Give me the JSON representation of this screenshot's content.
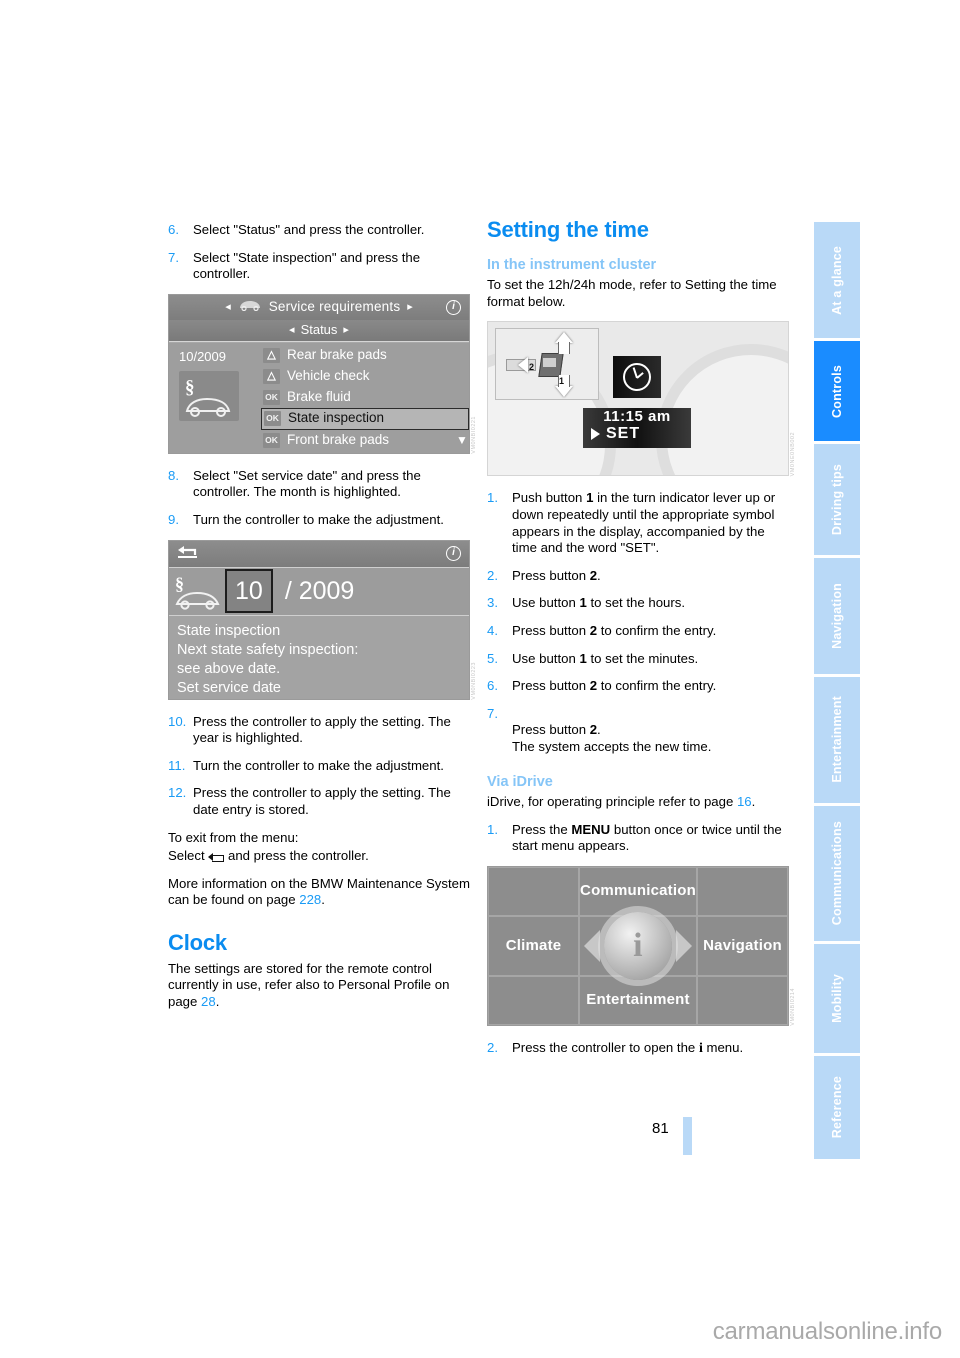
{
  "document": {
    "page_number": "81",
    "watermark": "carmanualsonline.info"
  },
  "tabs": [
    {
      "label": "At a glance",
      "active": false
    },
    {
      "label": "Controls",
      "active": true
    },
    {
      "label": "Driving tips",
      "active": false
    },
    {
      "label": "Navigation",
      "active": false
    },
    {
      "label": "Entertainment",
      "active": false
    },
    {
      "label": "Communications",
      "active": false
    },
    {
      "label": "Mobility",
      "active": false
    },
    {
      "label": "Reference",
      "active": false
    }
  ],
  "colors": {
    "accent_blue": "#0a8cf0",
    "step_number_blue": "#1a9bf5",
    "light_blue": "#85c5f7",
    "tab_inactive": "#b9d9f7",
    "tab_active": "#1a8cff"
  },
  "left_column": {
    "steps_top": [
      {
        "num": "6.",
        "text": "Select \"Status\" and press the controller."
      },
      {
        "num": "7.",
        "text": "Select \"State inspection\" and press the controller."
      }
    ],
    "figure_service": {
      "header_title": "Service requirements",
      "subheader": "Status",
      "date": "10/2009",
      "rows": [
        {
          "badge": "warn",
          "label": "Rear brake pads",
          "selected": false
        },
        {
          "badge": "warn",
          "label": "Vehicle check",
          "selected": false
        },
        {
          "badge": "OK",
          "label": "Brake fluid",
          "selected": false
        },
        {
          "badge": "OK",
          "label": "State inspection",
          "selected": true
        },
        {
          "badge": "OK",
          "label": "Front brake pads",
          "selected": false
        }
      ],
      "code": "VM0NBI0221"
    },
    "steps_mid": [
      {
        "num": "8.",
        "text": "Select \"Set service date\" and press the controller. The month is highlighted."
      },
      {
        "num": "9.",
        "text": "Turn the controller to make the adjustment."
      }
    ],
    "figure_date": {
      "month": "10",
      "year": "/ 2009",
      "lines": [
        "State inspection",
        "Next state safety inspection:",
        "see above date.",
        "Set service date"
      ],
      "code": "VM0NBI0223"
    },
    "steps_bottom": [
      {
        "num": "10.",
        "text": "Press the controller to apply the setting. The year is highlighted."
      },
      {
        "num": "11.",
        "text": "Turn the controller to make the adjustment."
      },
      {
        "num": "12.",
        "text": "Press the controller to apply the setting. The date entry is stored."
      }
    ],
    "exit_line1": "To exit from the menu:",
    "exit_line2_pre": "Select",
    "exit_line2_post": "and press the controller.",
    "more_info_pre": "More information on the BMW Maintenance System can be found on page",
    "more_info_page": "228",
    "more_info_post": ".",
    "clock_heading": "Clock",
    "clock_body_pre": "The settings are stored for the remote control currently in use, refer also to Personal Profile on page",
    "clock_body_page": "28",
    "clock_body_post": "."
  },
  "right_column": {
    "heading": "Setting the time",
    "subheading_cluster": "In the instrument cluster",
    "intro": "To set the 12h/24h mode, refer to Setting the time format below.",
    "figure_cluster": {
      "time": "11:15 am",
      "set_label": "SET",
      "button_1": "1",
      "button_2": "2",
      "code": "VM0NE0NB002"
    },
    "steps_cluster": [
      {
        "num": "1.",
        "parts": [
          "Push button ",
          "1",
          " in the turn indicator lever up or down repeatedly until the appropriate symbol appears in the display, accompanied by the time and the word \"SET\"."
        ]
      },
      {
        "num": "2.",
        "parts": [
          "Press button ",
          "2",
          "."
        ]
      },
      {
        "num": "3.",
        "parts": [
          "Use button ",
          "1",
          " to set the hours."
        ]
      },
      {
        "num": "4.",
        "parts": [
          "Press button ",
          "2",
          " to confirm the entry."
        ]
      },
      {
        "num": "5.",
        "parts": [
          "Use button ",
          "1",
          " to set the minutes."
        ]
      },
      {
        "num": "6.",
        "parts": [
          "Press button ",
          "2",
          " to confirm the entry."
        ]
      },
      {
        "num": "7.",
        "parts": [
          "Press button ",
          "2",
          ".\nThe system accepts the new time."
        ]
      }
    ],
    "subheading_idrive": "Via iDrive",
    "idrive_intro_pre": "iDrive, for operating principle refer to page",
    "idrive_intro_page": "16",
    "idrive_intro_post": ".",
    "step_menu": {
      "num": "1.",
      "pre": "Press the ",
      "bold": "MENU",
      "post": " button once or twice until the start menu appears."
    },
    "figure_startmenu": {
      "top": "Communication",
      "left": "Climate",
      "right": "Navigation",
      "bottom": "Entertainment",
      "center_icon": "i",
      "code": "VM0NBI0214"
    },
    "step_open": {
      "num": "2.",
      "pre": "Press the controller to open the ",
      "icon": "i",
      "post": " menu."
    }
  }
}
